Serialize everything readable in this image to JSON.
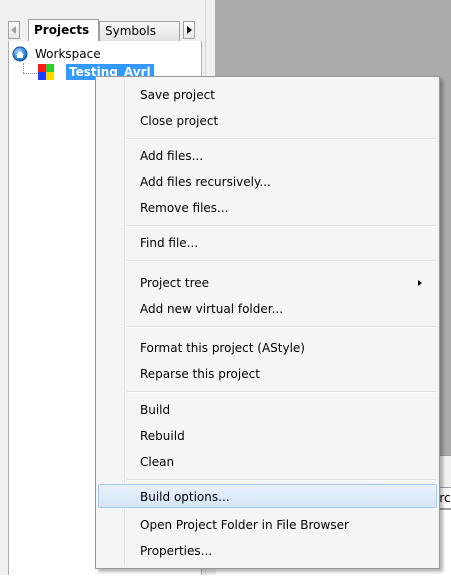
{
  "project_pane": {
    "tabs": [
      {
        "label": "Projects",
        "active": true
      },
      {
        "label": "Symbols",
        "active": false
      }
    ],
    "tree": {
      "workspace_label": "Workspace",
      "project_label": "Testing_Avrl",
      "project_selected": true
    }
  },
  "right_pane": {
    "tab_fragment": "arc"
  },
  "context_menu": {
    "items": [
      {
        "label": "Save project"
      },
      {
        "label": "Close project"
      },
      {
        "label": "Add files..."
      },
      {
        "label": "Add files recursively..."
      },
      {
        "label": "Remove files..."
      },
      {
        "label": "Find file..."
      },
      {
        "label": "Project tree",
        "has_submenu": true
      },
      {
        "label": "Add new virtual folder..."
      },
      {
        "label": "Format this project (AStyle)"
      },
      {
        "label": "Reparse this project"
      },
      {
        "label": "Build"
      },
      {
        "label": "Rebuild"
      },
      {
        "label": "Clean"
      },
      {
        "label": "Build options...",
        "highlighted": true
      },
      {
        "label": "Open Project Folder in File Browser"
      },
      {
        "label": "Properties..."
      }
    ]
  },
  "colors": {
    "selection": "#3399ff",
    "menu_background": "#f5f5f5",
    "menu_highlight": "#d5e5f7",
    "menu_highlight_border": "#a8c8ec",
    "editor_background": "#ababab"
  },
  "icons": {
    "workspace": "workspace-globe-icon",
    "project": "project-colored-squares-icon",
    "tab_scroll_left": "scroll-left-arrow-icon",
    "tab_scroll_right": "scroll-right-arrow-icon",
    "submenu": "submenu-arrow-icon"
  }
}
